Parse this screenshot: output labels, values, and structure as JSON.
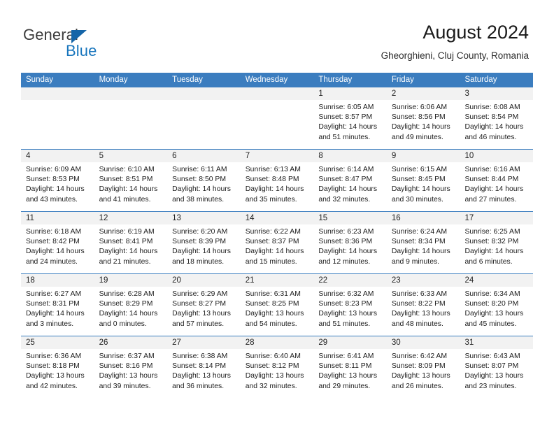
{
  "brand": {
    "name_part1": "General",
    "name_part2": "Blue",
    "flag_icon": "triangle-flag-icon",
    "accent_color": "#1976bd"
  },
  "header": {
    "title": "August 2024",
    "subtitle": "Gheorghieni, Cluj County, Romania"
  },
  "theme": {
    "header_blue": "#3b7dbf",
    "daynum_band": "#f2f2f2",
    "text": "#1c1c1c"
  },
  "calendar": {
    "weekday_headers": [
      "Sunday",
      "Monday",
      "Tuesday",
      "Wednesday",
      "Thursday",
      "Friday",
      "Saturday"
    ],
    "weeks": [
      [
        {
          "day": "",
          "lines": []
        },
        {
          "day": "",
          "lines": []
        },
        {
          "day": "",
          "lines": []
        },
        {
          "day": "",
          "lines": []
        },
        {
          "day": "1",
          "lines": [
            "Sunrise: 6:05 AM",
            "Sunset: 8:57 PM",
            "Daylight: 14 hours",
            "and 51 minutes."
          ]
        },
        {
          "day": "2",
          "lines": [
            "Sunrise: 6:06 AM",
            "Sunset: 8:56 PM",
            "Daylight: 14 hours",
            "and 49 minutes."
          ]
        },
        {
          "day": "3",
          "lines": [
            "Sunrise: 6:08 AM",
            "Sunset: 8:54 PM",
            "Daylight: 14 hours",
            "and 46 minutes."
          ]
        }
      ],
      [
        {
          "day": "4",
          "lines": [
            "Sunrise: 6:09 AM",
            "Sunset: 8:53 PM",
            "Daylight: 14 hours",
            "and 43 minutes."
          ]
        },
        {
          "day": "5",
          "lines": [
            "Sunrise: 6:10 AM",
            "Sunset: 8:51 PM",
            "Daylight: 14 hours",
            "and 41 minutes."
          ]
        },
        {
          "day": "6",
          "lines": [
            "Sunrise: 6:11 AM",
            "Sunset: 8:50 PM",
            "Daylight: 14 hours",
            "and 38 minutes."
          ]
        },
        {
          "day": "7",
          "lines": [
            "Sunrise: 6:13 AM",
            "Sunset: 8:48 PM",
            "Daylight: 14 hours",
            "and 35 minutes."
          ]
        },
        {
          "day": "8",
          "lines": [
            "Sunrise: 6:14 AM",
            "Sunset: 8:47 PM",
            "Daylight: 14 hours",
            "and 32 minutes."
          ]
        },
        {
          "day": "9",
          "lines": [
            "Sunrise: 6:15 AM",
            "Sunset: 8:45 PM",
            "Daylight: 14 hours",
            "and 30 minutes."
          ]
        },
        {
          "day": "10",
          "lines": [
            "Sunrise: 6:16 AM",
            "Sunset: 8:44 PM",
            "Daylight: 14 hours",
            "and 27 minutes."
          ]
        }
      ],
      [
        {
          "day": "11",
          "lines": [
            "Sunrise: 6:18 AM",
            "Sunset: 8:42 PM",
            "Daylight: 14 hours",
            "and 24 minutes."
          ]
        },
        {
          "day": "12",
          "lines": [
            "Sunrise: 6:19 AM",
            "Sunset: 8:41 PM",
            "Daylight: 14 hours",
            "and 21 minutes."
          ]
        },
        {
          "day": "13",
          "lines": [
            "Sunrise: 6:20 AM",
            "Sunset: 8:39 PM",
            "Daylight: 14 hours",
            "and 18 minutes."
          ]
        },
        {
          "day": "14",
          "lines": [
            "Sunrise: 6:22 AM",
            "Sunset: 8:37 PM",
            "Daylight: 14 hours",
            "and 15 minutes."
          ]
        },
        {
          "day": "15",
          "lines": [
            "Sunrise: 6:23 AM",
            "Sunset: 8:36 PM",
            "Daylight: 14 hours",
            "and 12 minutes."
          ]
        },
        {
          "day": "16",
          "lines": [
            "Sunrise: 6:24 AM",
            "Sunset: 8:34 PM",
            "Daylight: 14 hours",
            "and 9 minutes."
          ]
        },
        {
          "day": "17",
          "lines": [
            "Sunrise: 6:25 AM",
            "Sunset: 8:32 PM",
            "Daylight: 14 hours",
            "and 6 minutes."
          ]
        }
      ],
      [
        {
          "day": "18",
          "lines": [
            "Sunrise: 6:27 AM",
            "Sunset: 8:31 PM",
            "Daylight: 14 hours",
            "and 3 minutes."
          ]
        },
        {
          "day": "19",
          "lines": [
            "Sunrise: 6:28 AM",
            "Sunset: 8:29 PM",
            "Daylight: 14 hours",
            "and 0 minutes."
          ]
        },
        {
          "day": "20",
          "lines": [
            "Sunrise: 6:29 AM",
            "Sunset: 8:27 PM",
            "Daylight: 13 hours",
            "and 57 minutes."
          ]
        },
        {
          "day": "21",
          "lines": [
            "Sunrise: 6:31 AM",
            "Sunset: 8:25 PM",
            "Daylight: 13 hours",
            "and 54 minutes."
          ]
        },
        {
          "day": "22",
          "lines": [
            "Sunrise: 6:32 AM",
            "Sunset: 8:23 PM",
            "Daylight: 13 hours",
            "and 51 minutes."
          ]
        },
        {
          "day": "23",
          "lines": [
            "Sunrise: 6:33 AM",
            "Sunset: 8:22 PM",
            "Daylight: 13 hours",
            "and 48 minutes."
          ]
        },
        {
          "day": "24",
          "lines": [
            "Sunrise: 6:34 AM",
            "Sunset: 8:20 PM",
            "Daylight: 13 hours",
            "and 45 minutes."
          ]
        }
      ],
      [
        {
          "day": "25",
          "lines": [
            "Sunrise: 6:36 AM",
            "Sunset: 8:18 PM",
            "Daylight: 13 hours",
            "and 42 minutes."
          ]
        },
        {
          "day": "26",
          "lines": [
            "Sunrise: 6:37 AM",
            "Sunset: 8:16 PM",
            "Daylight: 13 hours",
            "and 39 minutes."
          ]
        },
        {
          "day": "27",
          "lines": [
            "Sunrise: 6:38 AM",
            "Sunset: 8:14 PM",
            "Daylight: 13 hours",
            "and 36 minutes."
          ]
        },
        {
          "day": "28",
          "lines": [
            "Sunrise: 6:40 AM",
            "Sunset: 8:12 PM",
            "Daylight: 13 hours",
            "and 32 minutes."
          ]
        },
        {
          "day": "29",
          "lines": [
            "Sunrise: 6:41 AM",
            "Sunset: 8:11 PM",
            "Daylight: 13 hours",
            "and 29 minutes."
          ]
        },
        {
          "day": "30",
          "lines": [
            "Sunrise: 6:42 AM",
            "Sunset: 8:09 PM",
            "Daylight: 13 hours",
            "and 26 minutes."
          ]
        },
        {
          "day": "31",
          "lines": [
            "Sunrise: 6:43 AM",
            "Sunset: 8:07 PM",
            "Daylight: 13 hours",
            "and 23 minutes."
          ]
        }
      ]
    ]
  }
}
